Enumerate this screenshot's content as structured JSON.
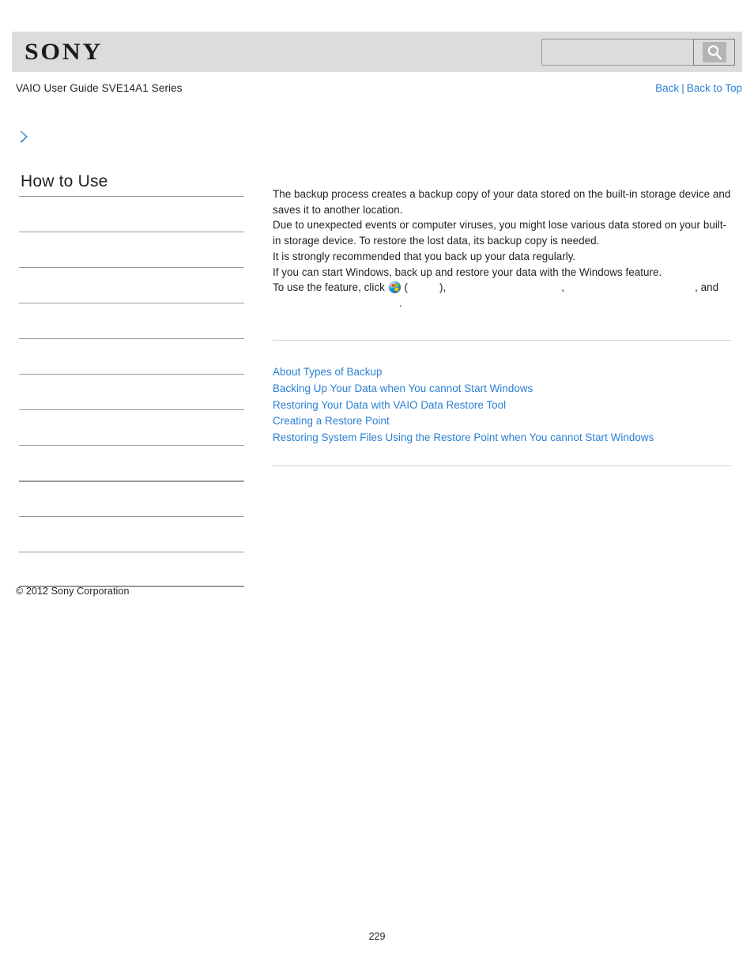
{
  "header": {
    "logo_text": "SONY",
    "search": {
      "value": "",
      "placeholder": "",
      "button_icon": "search-icon"
    }
  },
  "subheader": {
    "guide_title": "VAIO User Guide SVE14A1 Series",
    "back_label": "Back",
    "separator": "|",
    "back_to_top_label": "Back to Top"
  },
  "breadcrumb": {
    "icon": "chevron-right-icon",
    "text": ""
  },
  "sidebar": {
    "title": "How to Use",
    "items": [
      {
        "label": ""
      },
      {
        "label": ""
      },
      {
        "label": ""
      },
      {
        "label": ""
      },
      {
        "label": ""
      },
      {
        "label": ""
      },
      {
        "label": ""
      },
      {
        "label": ""
      },
      {
        "label": ""
      },
      {
        "label": ""
      },
      {
        "label": ""
      }
    ],
    "copyright": "© 2012 Sony Corporation"
  },
  "content": {
    "paragraphs": [
      "The backup process creates a backup copy of your data stored on the built-in storage device and saves it to another location.",
      "Due to unexpected events or computer viruses, you might lose various data stored on your built-in storage device. To restore the lost data, its backup copy is needed.",
      "It is strongly recommended that you back up your data regularly.",
      "If you can start Windows, back up and restore your data with the Windows feature."
    ],
    "feature_line": {
      "prefix": "To use the feature, click",
      "orb_icon": "windows-start-orb-icon",
      "open_paren": "(",
      "blank_1": "",
      "close_paren": "),",
      "blank_2": "",
      "comma_1": ",",
      "blank_3": "",
      "suffix": ", and",
      "blank_4": "",
      "period": "."
    },
    "related_links": [
      "About Types of Backup",
      "Backing Up Your Data when You cannot Start Windows",
      "Restoring Your Data with VAIO Data Restore Tool",
      "Creating a Restore Point",
      "Restoring System Files Using the Restore Point when You cannot Start Windows"
    ]
  },
  "footer": {
    "page_number": "229"
  },
  "colors": {
    "link": "#2a7fd4",
    "header_bar": "#dcdcdc",
    "text": "#231f20",
    "rule": "#cfcfcf",
    "sidebar_rule": "#9b9b9b"
  }
}
